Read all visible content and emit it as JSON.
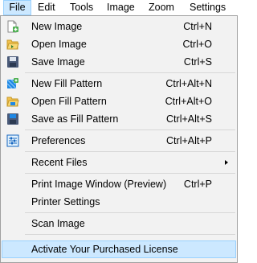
{
  "menubar": {
    "items": [
      "File",
      "Edit",
      "Tools",
      "Image",
      "Zoom",
      "Settings"
    ]
  },
  "file_menu": {
    "new_image": {
      "label": "New Image",
      "shortcut": "Ctrl+N"
    },
    "open_image": {
      "label": "Open Image",
      "shortcut": "Ctrl+O"
    },
    "save_image": {
      "label": "Save Image",
      "shortcut": "Ctrl+S"
    },
    "new_fill_pattern": {
      "label": "New Fill Pattern",
      "shortcut": "Ctrl+Alt+N"
    },
    "open_fill_pattern": {
      "label": "Open Fill Pattern",
      "shortcut": "Ctrl+Alt+O"
    },
    "save_fill_pattern": {
      "label": "Save as Fill Pattern",
      "shortcut": "Ctrl+Alt+S"
    },
    "preferences": {
      "label": "Preferences",
      "shortcut": "Ctrl+Alt+P"
    },
    "recent_files": {
      "label": "Recent Files"
    },
    "print_window": {
      "label": "Print Image Window (Preview)",
      "shortcut": "Ctrl+P"
    },
    "printer_settings": {
      "label": "Printer Settings"
    },
    "scan_image": {
      "label": "Scan Image"
    },
    "activate_license": {
      "label": "Activate Your Purchased License"
    }
  },
  "colors": {
    "highlight_fill": "#cce8ff",
    "highlight_border": "#99d1ff",
    "menu_bg": "#f2f2f2"
  }
}
